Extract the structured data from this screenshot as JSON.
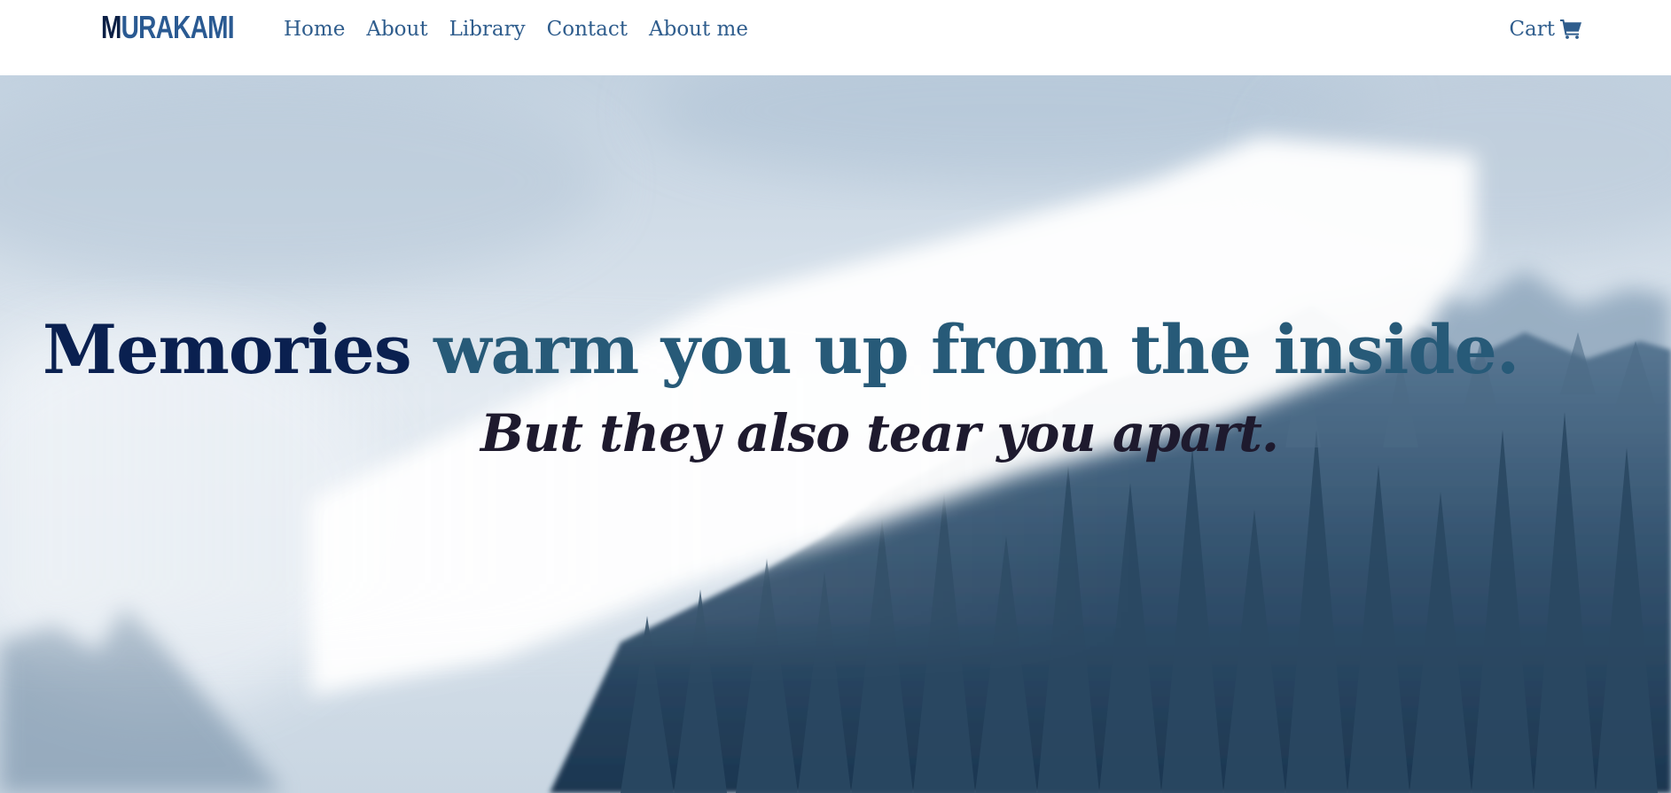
{
  "nav": {
    "logo_first": "M",
    "logo_rest": "URAKAMI",
    "links": [
      "Home",
      "About",
      "Library",
      "Contact",
      "About me"
    ],
    "cart_label": "Cart",
    "cart_icon": "shopping-cart-icon"
  },
  "hero": {
    "headline_part1": "Memories",
    "headline_part2": "warm you up from the inside.",
    "subline": "But they also tear you apart.",
    "background": "misty-forest-photo"
  },
  "colors": {
    "nav_text": "#2f5d8d",
    "logo_dark": "#0b1f45",
    "headline_dark": "#0a2050",
    "headline_teal": "#275a78",
    "subline": "#1e1a2e"
  }
}
